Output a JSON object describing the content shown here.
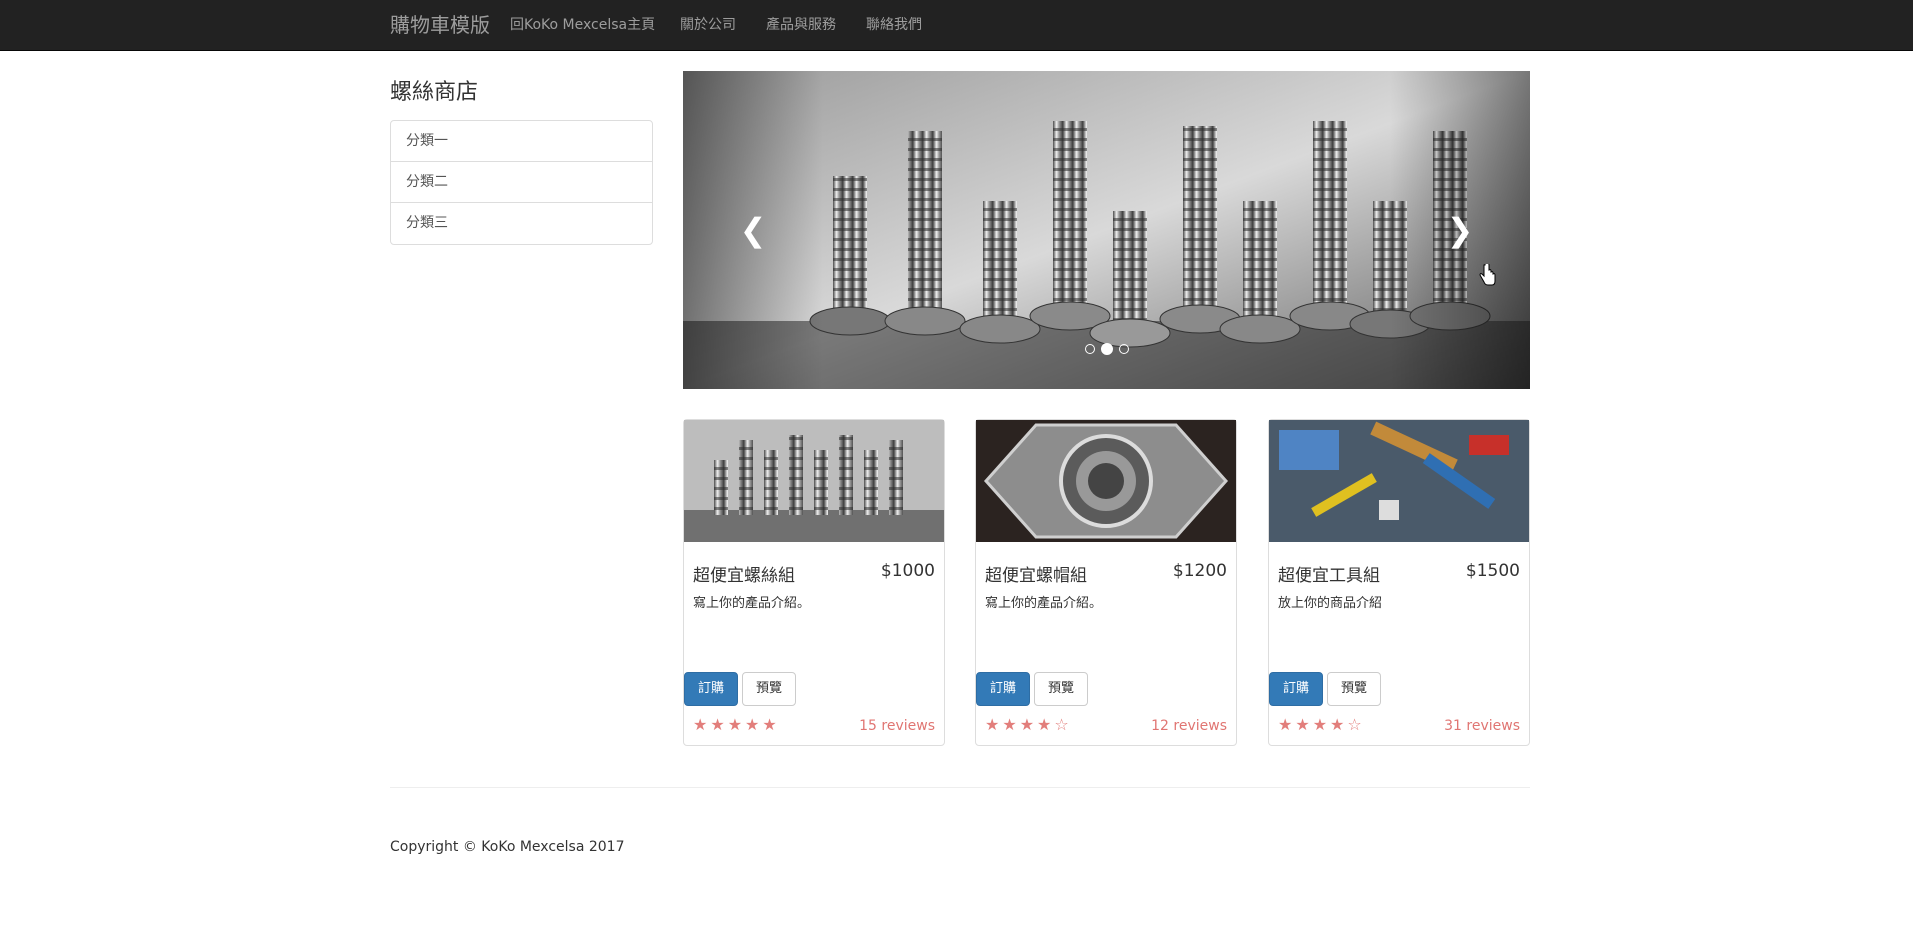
{
  "navbar": {
    "brand": "購物車模版",
    "links": [
      "回KoKo Mexcelsa主頁",
      "關於公司",
      "產品與服務",
      "聯絡我們"
    ]
  },
  "sidebar": {
    "title": "螺絲商店",
    "items": [
      "分類一",
      "分類二",
      "分類三"
    ]
  },
  "carousel": {
    "prev_icon": "chevron-left-icon",
    "next_icon": "chevron-right-icon",
    "slide_count": 3,
    "active_index": 1
  },
  "products": [
    {
      "name": "超便宜螺絲組",
      "price": "$1000",
      "desc": "寫上你的產品介紹。",
      "order_label": "訂購",
      "preview_label": "預覽",
      "stars": "★★★★★",
      "rating": 5,
      "reviews": "15 reviews"
    },
    {
      "name": "超便宜螺帽組",
      "price": "$1200",
      "desc": "寫上你的產品介紹。",
      "order_label": "訂購",
      "preview_label": "預覽",
      "stars": "★★★★☆",
      "rating": 4,
      "reviews": "12 reviews"
    },
    {
      "name": "超便宜工具組",
      "price": "$1500",
      "desc": "放上你的商品介紹",
      "order_label": "訂購",
      "preview_label": "預覽",
      "stars": "★★★★☆",
      "rating": 4,
      "reviews": "31 reviews"
    }
  ],
  "footer": {
    "copyright": "Copyright © KoKo Mexcelsa 2017"
  },
  "colors": {
    "navbar_bg": "#222222",
    "primary": "#337ab7",
    "star": "#d9534f"
  }
}
